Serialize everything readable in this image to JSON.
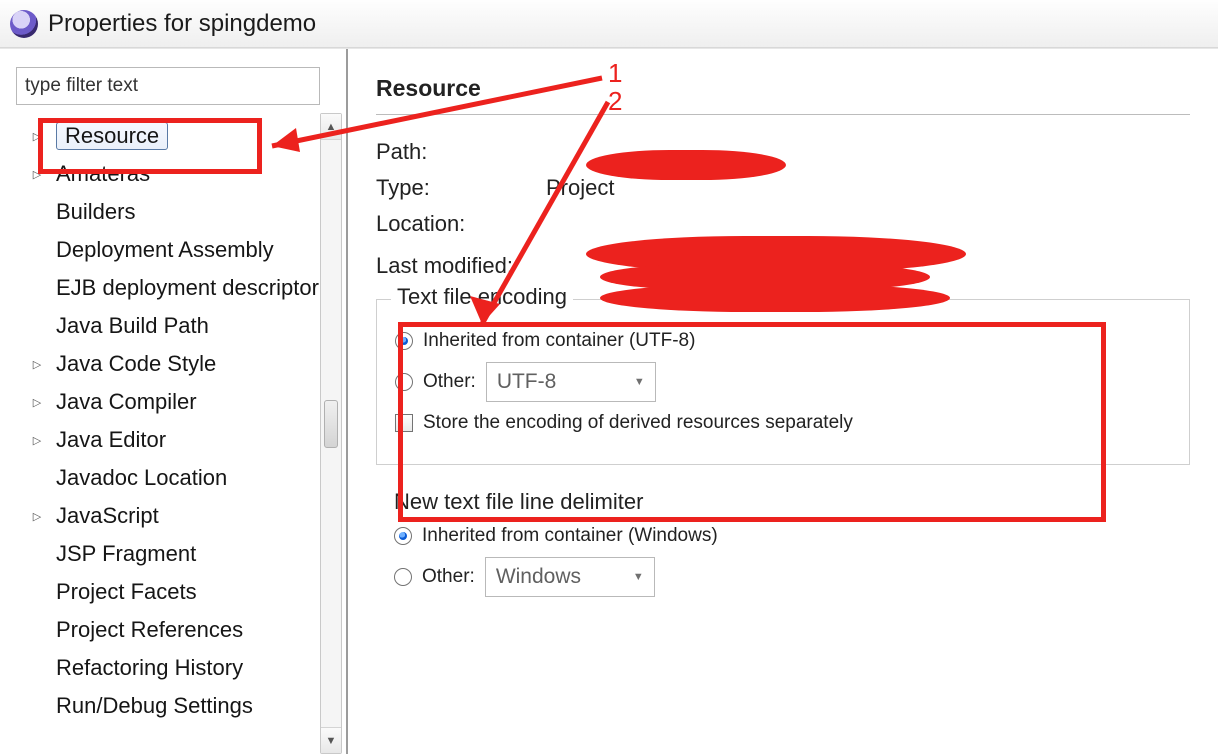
{
  "window": {
    "title": "Properties for spingdemo"
  },
  "left": {
    "filter_placeholder": "type filter text",
    "items": [
      {
        "label": "Resource",
        "expandable": true,
        "selected": true
      },
      {
        "label": "Amateras",
        "expandable": true,
        "selected": false
      },
      {
        "label": "Builders",
        "expandable": false,
        "selected": false
      },
      {
        "label": "Deployment Assembly",
        "expandable": false,
        "selected": false
      },
      {
        "label": "EJB deployment descriptor",
        "expandable": false,
        "selected": false
      },
      {
        "label": "Java Build Path",
        "expandable": false,
        "selected": false
      },
      {
        "label": "Java Code Style",
        "expandable": true,
        "selected": false
      },
      {
        "label": "Java Compiler",
        "expandable": true,
        "selected": false
      },
      {
        "label": "Java Editor",
        "expandable": true,
        "selected": false
      },
      {
        "label": "Javadoc Location",
        "expandable": false,
        "selected": false
      },
      {
        "label": "JavaScript",
        "expandable": true,
        "selected": false
      },
      {
        "label": "JSP Fragment",
        "expandable": false,
        "selected": false
      },
      {
        "label": "Project Facets",
        "expandable": false,
        "selected": false
      },
      {
        "label": "Project References",
        "expandable": false,
        "selected": false
      },
      {
        "label": "Refactoring History",
        "expandable": false,
        "selected": false
      },
      {
        "label": "Run/Debug Settings",
        "expandable": false,
        "selected": false
      }
    ]
  },
  "right": {
    "heading": "Resource",
    "fields": {
      "path_label": "Path:",
      "type_label": "Type:",
      "type_value": "Project",
      "location_label": "Location:",
      "modified_label": "Last modified:"
    },
    "encoding_group": {
      "legend": "Text file encoding",
      "inherited_label": "Inherited from container (UTF-8)",
      "other_label": "Other:",
      "other_value": "UTF-8",
      "store_label": "Store the encoding of derived resources separately"
    },
    "delimiter_group": {
      "legend": "New text file line delimiter",
      "inherited_label": "Inherited from container (Windows)",
      "other_label": "Other:",
      "other_value": "Windows"
    }
  },
  "annotations": {
    "num1": "1",
    "num2": "2"
  }
}
